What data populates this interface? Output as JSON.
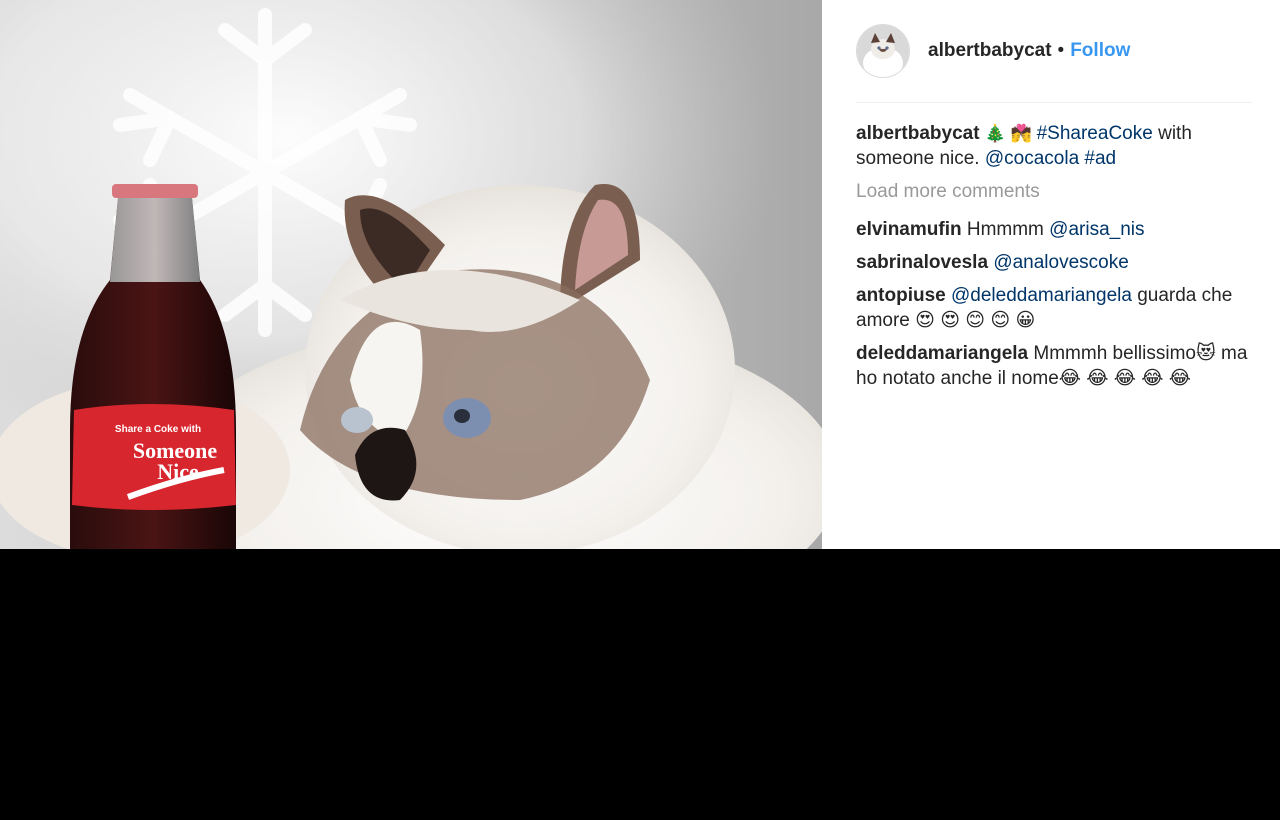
{
  "post": {
    "photo_alt": "",
    "author": "albertbabycat",
    "separator": "•",
    "follow_label": "Follow"
  },
  "caption": {
    "user": "albertbabycat",
    "emojis": "🎄 💏 ",
    "hashtag1": "#ShareaCoke",
    "text1": " with someone nice. ",
    "mention": "@cocacola",
    "space": " ",
    "hashtag2": "#ad"
  },
  "load_more_label": "Load more comments",
  "comments": [
    {
      "user": "elvinamufin",
      "text": " Hmmmm ",
      "mention": "@arisa_nis",
      "tail": ""
    },
    {
      "user": "sabrinalovesla",
      "text": " ",
      "mention": "@analovescoke",
      "tail": ""
    },
    {
      "user": "antopiuse",
      "text": " ",
      "mention": "@deleddamariangela",
      "tail": " guarda che amore 😍 😍 😊 😊 😀"
    },
    {
      "user": "deleddamariangela",
      "text": " Mmmmh bellissimo😻 ma ho notato anche il nome😂 😂 😂 😂 😂",
      "mention": "",
      "tail": ""
    }
  ],
  "bottle_label": {
    "line1": "Share a Coke with",
    "line2": "Someone",
    "line3": "Nice"
  },
  "colors": {
    "follow": "#3897f0",
    "link": "#003569",
    "muted": "#999999",
    "text": "#262626",
    "coke_red": "#d8262e"
  }
}
